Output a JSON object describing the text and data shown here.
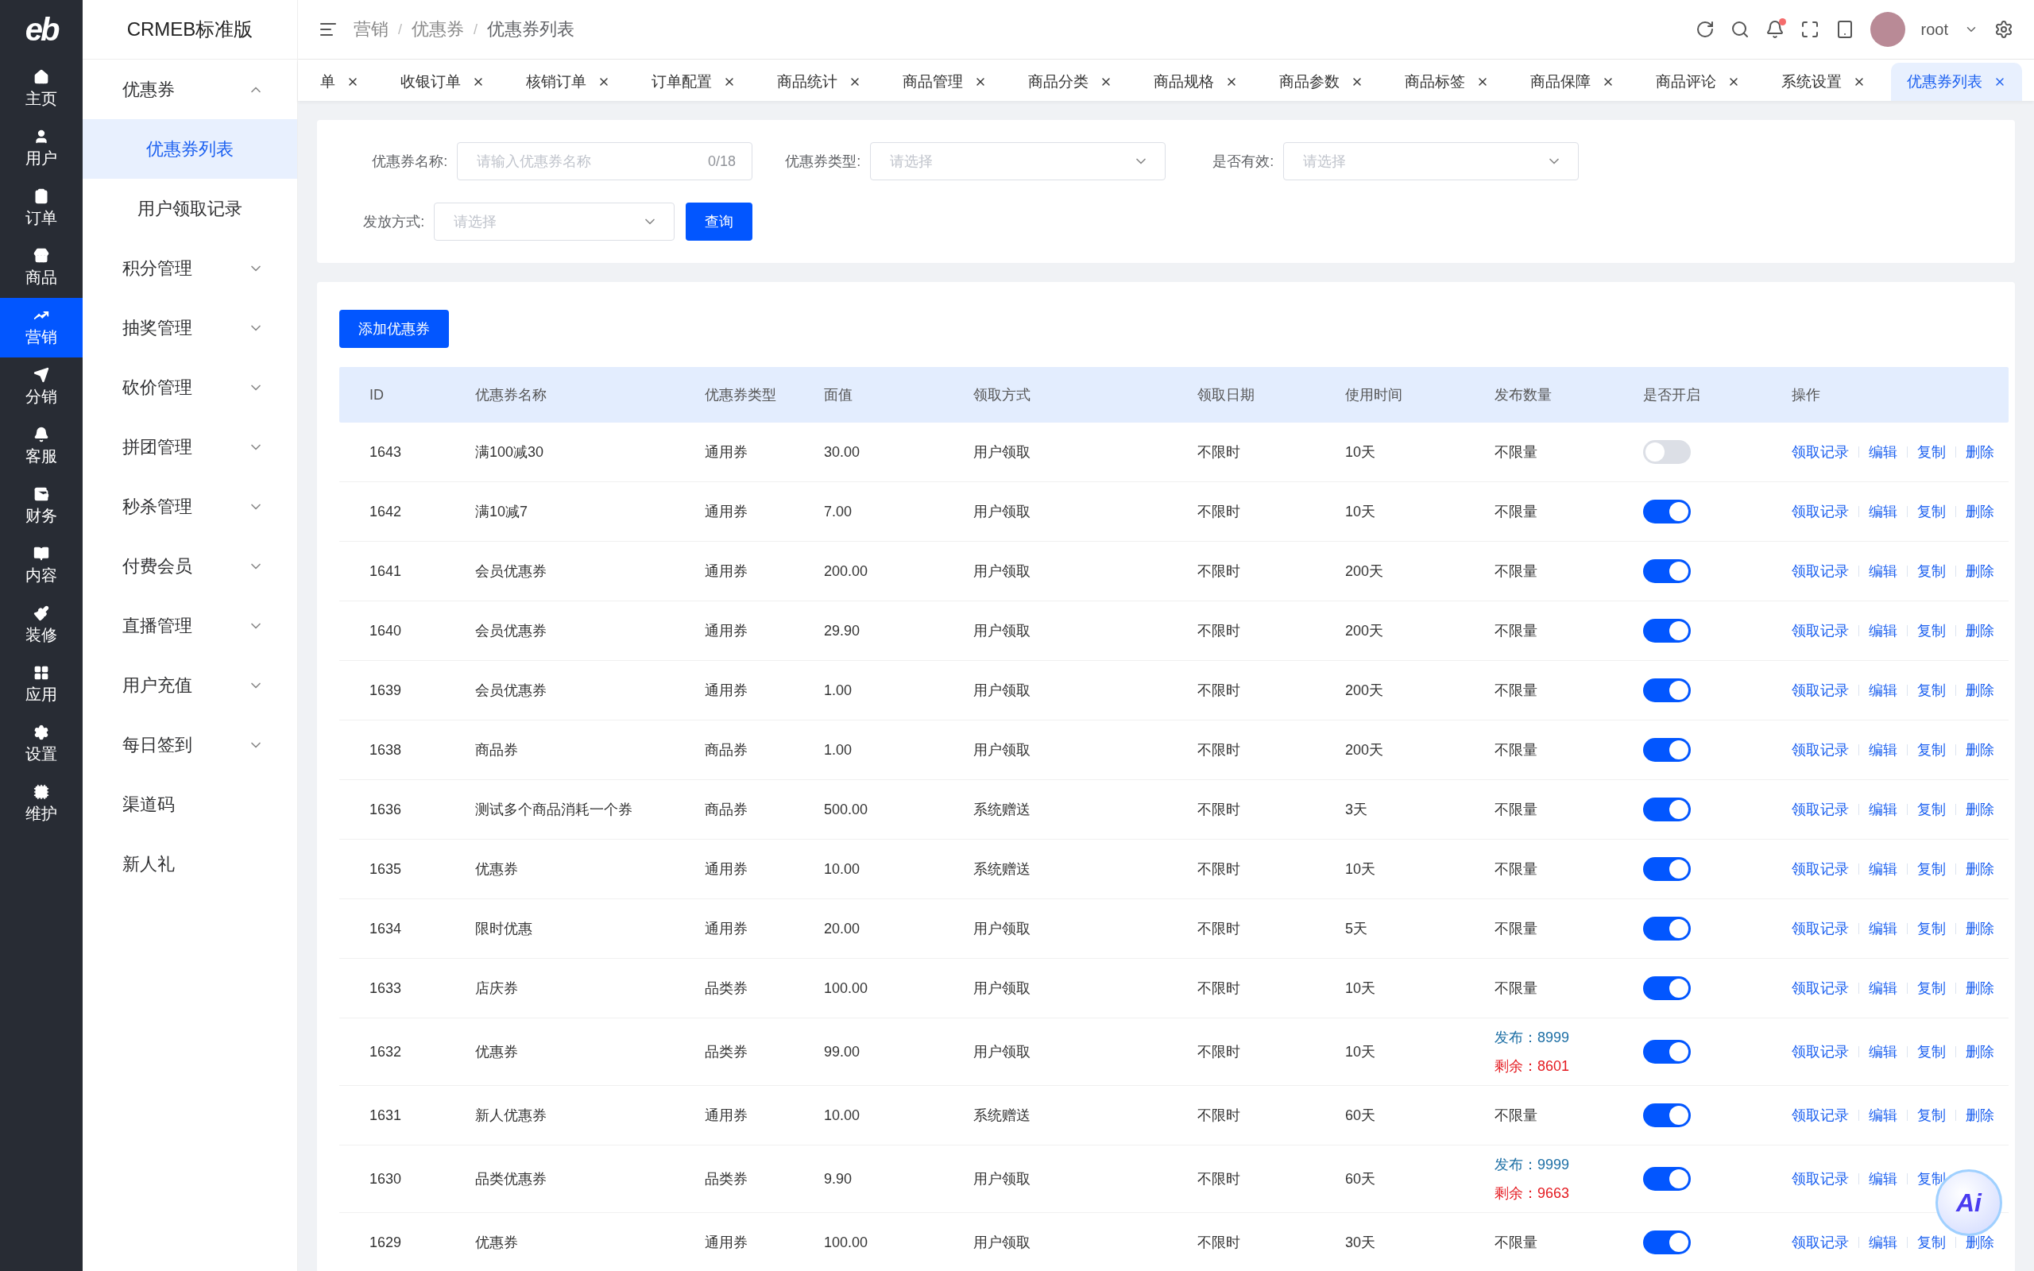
{
  "logo": "eb",
  "rail": [
    {
      "label": "主页",
      "selected": false
    },
    {
      "label": "用户",
      "selected": false
    },
    {
      "label": "订单",
      "selected": false
    },
    {
      "label": "商品",
      "selected": false
    },
    {
      "label": "营销",
      "selected": true
    },
    {
      "label": "分销",
      "selected": false
    },
    {
      "label": "客服",
      "selected": false
    },
    {
      "label": "财务",
      "selected": false
    },
    {
      "label": "内容",
      "selected": false
    },
    {
      "label": "装修",
      "selected": false
    },
    {
      "label": "应用",
      "selected": false
    },
    {
      "label": "设置",
      "selected": false
    },
    {
      "label": "维护",
      "selected": false
    }
  ],
  "menu": {
    "title": "CRMEB标准版",
    "items": [
      {
        "kind": "group",
        "label": "优惠券",
        "expanded": true,
        "children": [
          {
            "label": "优惠券列表",
            "selected": true
          },
          {
            "label": "用户领取记录",
            "selected": false
          }
        ]
      },
      {
        "kind": "group",
        "label": "积分管理",
        "expanded": false
      },
      {
        "kind": "group",
        "label": "抽奖管理",
        "expanded": false
      },
      {
        "kind": "group",
        "label": "砍价管理",
        "expanded": false
      },
      {
        "kind": "group",
        "label": "拼团管理",
        "expanded": false
      },
      {
        "kind": "group",
        "label": "秒杀管理",
        "expanded": false
      },
      {
        "kind": "group",
        "label": "付费会员",
        "expanded": false
      },
      {
        "kind": "group",
        "label": "直播管理",
        "expanded": false
      },
      {
        "kind": "group",
        "label": "用户充值",
        "expanded": false
      },
      {
        "kind": "group",
        "label": "每日签到",
        "expanded": false
      },
      {
        "kind": "link",
        "label": "渠道码"
      },
      {
        "kind": "link",
        "label": "新人礼"
      }
    ]
  },
  "breadcrumb": {
    "separator": "/",
    "items": [
      "营销",
      "优惠券",
      "优惠券列表"
    ]
  },
  "header": {
    "user": "root",
    "unread": true
  },
  "tabs": [
    {
      "label": "单",
      "selected": false
    },
    {
      "label": "收银订单",
      "selected": false
    },
    {
      "label": "核销订单",
      "selected": false
    },
    {
      "label": "订单配置",
      "selected": false
    },
    {
      "label": "商品统计",
      "selected": false
    },
    {
      "label": "商品管理",
      "selected": false
    },
    {
      "label": "商品分类",
      "selected": false
    },
    {
      "label": "商品规格",
      "selected": false
    },
    {
      "label": "商品参数",
      "selected": false
    },
    {
      "label": "商品标签",
      "selected": false
    },
    {
      "label": "商品保障",
      "selected": false
    },
    {
      "label": "商品评论",
      "selected": false
    },
    {
      "label": "系统设置",
      "selected": false
    },
    {
      "label": "优惠券列表",
      "selected": true
    }
  ],
  "filters": [
    {
      "kind": "input",
      "label": "优惠券名称:",
      "placeholder": "请输入优惠券名称",
      "counter": "0/18"
    },
    {
      "kind": "select",
      "label": "优惠券类型:",
      "placeholder": "请选择"
    },
    {
      "kind": "select",
      "label": "是否有效:",
      "placeholder": "请选择"
    },
    {
      "kind": "select",
      "label": "发放方式:",
      "placeholder": "请选择"
    }
  ],
  "search_button": "查询",
  "add_button": "添加优惠券",
  "table": {
    "columns": [
      "ID",
      "优惠券名称",
      "优惠券类型",
      "面值",
      "领取方式",
      "领取日期",
      "使用时间",
      "发布数量",
      "是否开启",
      "操作"
    ],
    "rows": [
      {
        "id": "1643",
        "name": "满100减30",
        "type": "通用券",
        "value": "30.00",
        "method": "用户领取",
        "date": "不限时",
        "duration": "10天",
        "quantity": {
          "kind": "unlimited",
          "text": "不限量"
        },
        "enabled": false,
        "actions": [
          "领取记录",
          "编辑",
          "复制",
          "删除"
        ]
      },
      {
        "id": "1642",
        "name": "满10减7",
        "type": "通用券",
        "value": "7.00",
        "method": "用户领取",
        "date": "不限时",
        "duration": "10天",
        "quantity": {
          "kind": "unlimited",
          "text": "不限量"
        },
        "enabled": true,
        "actions": [
          "领取记录",
          "编辑",
          "复制",
          "删除"
        ]
      },
      {
        "id": "1641",
        "name": "会员优惠券",
        "type": "通用券",
        "value": "200.00",
        "method": "用户领取",
        "date": "不限时",
        "duration": "200天",
        "quantity": {
          "kind": "unlimited",
          "text": "不限量"
        },
        "enabled": true,
        "actions": [
          "领取记录",
          "编辑",
          "复制",
          "删除"
        ]
      },
      {
        "id": "1640",
        "name": "会员优惠券",
        "type": "通用券",
        "value": "29.90",
        "method": "用户领取",
        "date": "不限时",
        "duration": "200天",
        "quantity": {
          "kind": "unlimited",
          "text": "不限量"
        },
        "enabled": true,
        "actions": [
          "领取记录",
          "编辑",
          "复制",
          "删除"
        ]
      },
      {
        "id": "1639",
        "name": "会员优惠券",
        "type": "通用券",
        "value": "1.00",
        "method": "用户领取",
        "date": "不限时",
        "duration": "200天",
        "quantity": {
          "kind": "unlimited",
          "text": "不限量"
        },
        "enabled": true,
        "actions": [
          "领取记录",
          "编辑",
          "复制",
          "删除"
        ]
      },
      {
        "id": "1638",
        "name": "商品券",
        "type": "商品券",
        "value": "1.00",
        "method": "用户领取",
        "date": "不限时",
        "duration": "200天",
        "quantity": {
          "kind": "unlimited",
          "text": "不限量"
        },
        "enabled": true,
        "actions": [
          "领取记录",
          "编辑",
          "复制",
          "删除"
        ]
      },
      {
        "id": "1636",
        "name": "测试多个商品消耗一个券",
        "type": "商品券",
        "value": "500.00",
        "method": "系统赠送",
        "date": "不限时",
        "duration": "3天",
        "quantity": {
          "kind": "unlimited",
          "text": "不限量"
        },
        "enabled": true,
        "actions": [
          "领取记录",
          "编辑",
          "复制",
          "删除"
        ]
      },
      {
        "id": "1635",
        "name": "优惠券",
        "type": "通用券",
        "value": "10.00",
        "method": "系统赠送",
        "date": "不限时",
        "duration": "10天",
        "quantity": {
          "kind": "unlimited",
          "text": "不限量"
        },
        "enabled": true,
        "actions": [
          "领取记录",
          "编辑",
          "复制",
          "删除"
        ]
      },
      {
        "id": "1634",
        "name": "限时优惠",
        "type": "通用券",
        "value": "20.00",
        "method": "用户领取",
        "date": "不限时",
        "duration": "5天",
        "quantity": {
          "kind": "unlimited",
          "text": "不限量"
        },
        "enabled": true,
        "actions": [
          "领取记录",
          "编辑",
          "复制",
          "删除"
        ]
      },
      {
        "id": "1633",
        "name": "店庆券",
        "type": "品类券",
        "value": "100.00",
        "method": "用户领取",
        "date": "不限时",
        "duration": "10天",
        "quantity": {
          "kind": "unlimited",
          "text": "不限量"
        },
        "enabled": true,
        "actions": [
          "领取记录",
          "编辑",
          "复制",
          "删除"
        ]
      },
      {
        "id": "1632",
        "name": "优惠券",
        "type": "品类券",
        "value": "99.00",
        "method": "用户领取",
        "date": "不限时",
        "duration": "10天",
        "quantity": {
          "kind": "limited",
          "issued": "发布：8999",
          "remaining": "剩余：8601"
        },
        "enabled": true,
        "actions": [
          "领取记录",
          "编辑",
          "复制",
          "删除"
        ]
      },
      {
        "id": "1631",
        "name": "新人优惠券",
        "type": "通用券",
        "value": "10.00",
        "method": "系统赠送",
        "date": "不限时",
        "duration": "60天",
        "quantity": {
          "kind": "unlimited",
          "text": "不限量"
        },
        "enabled": true,
        "actions": [
          "领取记录",
          "编辑",
          "复制",
          "删除"
        ]
      },
      {
        "id": "1630",
        "name": "品类优惠券",
        "type": "品类券",
        "value": "9.90",
        "method": "用户领取",
        "date": "不限时",
        "duration": "60天",
        "quantity": {
          "kind": "limited",
          "issued": "发布：9999",
          "remaining": "剩余：9663"
        },
        "enabled": true,
        "actions": [
          "领取记录",
          "编辑",
          "复制"
        ]
      },
      {
        "id": "1629",
        "name": "优惠券",
        "type": "通用券",
        "value": "100.00",
        "method": "用户领取",
        "date": "不限时",
        "duration": "30天",
        "quantity": {
          "kind": "unlimited",
          "text": "不限量"
        },
        "enabled": true,
        "actions": [
          "领取记录",
          "编辑",
          "复制",
          "删除"
        ]
      }
    ]
  },
  "ai_button": "Ai"
}
